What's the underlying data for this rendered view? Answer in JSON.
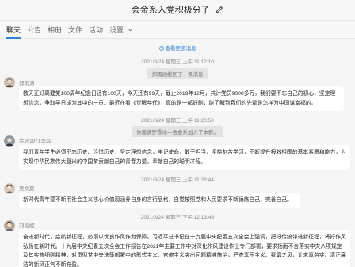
{
  "window": {
    "title": "会金系入党积极分子"
  },
  "tabs": [
    {
      "label": "聊天"
    },
    {
      "label": "公告"
    },
    {
      "label": "相册"
    },
    {
      "label": "文件"
    },
    {
      "label": "活动"
    },
    {
      "label": "设置"
    }
  ],
  "chat": {
    "load_more": "查看更多消息",
    "messages": [
      {
        "timestamp": "2021/3/24 星期三 上午 11:12:10",
        "system": "郑雨涵撤回了一条消息",
        "sender": "郑雨涵",
        "text": "教天正好离建党100周年纪念日还有100天，今天还有99天，截止2019年12月，共计党员9000多万，我们要不忘自己的初心，坚定理想信念，争取早日成为其中的一员。最近在看《觉醒年代》，真的是一部好剧，能了解到我们的先辈是怎样为中国谋幸福的。"
      },
      {
        "timestamp": "2021/3/24 星期三 上午 11:20:50",
        "system": "你邀请罗雪冰—会金系加入了本群。",
        "sender": "会计1971李菲",
        "text": "我们青年学生必须不忘历史、珍惜历史，坚定理想信念，牢记使命，敢于担当，坚持刻苦学习，不断提升报效祖国的基本素质和能力，为实现中华民族伟大复兴的中国梦贡献自己的青春力量，奉献自己的聪明才智。"
      },
      {
        "timestamp": "2021/3/24 星期三 上午 11:28:44",
        "sender": "吴文夏",
        "text": "新时代青年要不断用社会主义核心价值观涵养自身的言行品格，自觉按照党和人民要求不断锤炼自己，完善自己。"
      },
      {
        "timestamp": "2021/3/24 星期三 下午 12:13:43",
        "sender": "刘雪妮",
        "text": "奋进新时代，启航新征程，必须以优良作风作为保障。习近平总书记在十九届中央纪委五次全会上强调，把好传统带进新征程，将好作风弘扬在新时代。十九届中央纪委五次全会工作报告在2021年主要工作中对深化作风建设作出专门部署，要求扬而不舍落实中央八项规定及其实施细则精神，对贯彻党中央决策部署中的形式主义、官僚主义突出问题精准施治，严查享乐主义、奢靡之风，让求真务实、清正廉洁的新风正气不断充盈。"
      }
    ]
  },
  "colors": {
    "accent": "#2e80d8",
    "bubble": "#ffffff",
    "background": "#f5f5f5"
  }
}
